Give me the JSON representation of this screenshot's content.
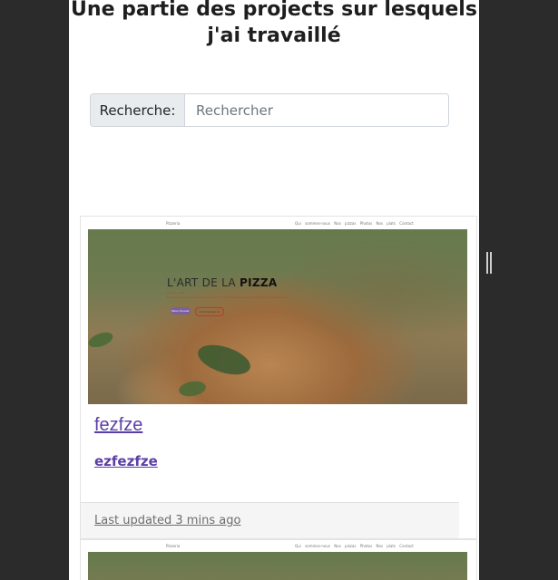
{
  "page": {
    "title": "Une partie des projects sur lesquels j'ai travaillé"
  },
  "search": {
    "label": "Recherche:",
    "placeholder": "Rechercher"
  },
  "projects": [
    {
      "preview": {
        "brand": "Pizzeria",
        "nav_links": "Qui sommes-nous  Nos pizzas  Photos  Nos plats  Contact",
        "hero_title_light": "L'ART DE LA ",
        "hero_title_bold": "PIZZA",
        "hero_sub": "Depuis 1975",
        "hero_text": "Notre pizzeria vous accueille dans un cadre chaleureux avec des recettes traditionnelles",
        "btn_primary": "Nous trouver",
        "btn_secondary": "Commander ici"
      },
      "title": "fezfze",
      "subtitle": "ezfezfze",
      "footer": "Last updated 3 mins ago"
    },
    {
      "preview": {
        "brand": "Pizzeria",
        "nav_links": "Qui sommes-nous  Nos pizzas  Photos  Nos plats  Contact"
      }
    }
  ],
  "colors": {
    "accent": "#5b3ea6",
    "background": "#2b2b2b",
    "input_group_bg": "#e9ecef"
  }
}
